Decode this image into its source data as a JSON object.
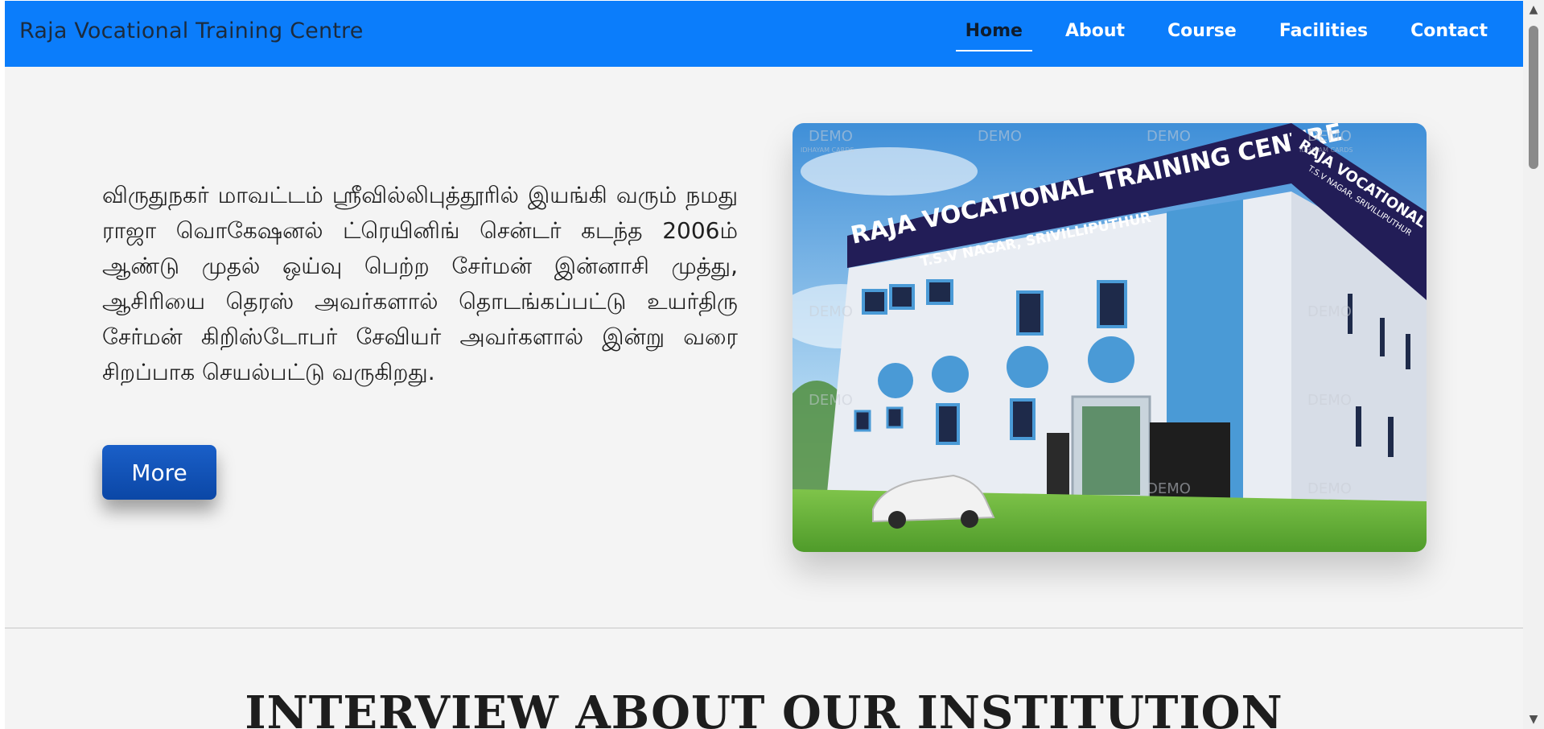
{
  "navbar": {
    "brand": "Raja Vocational Training Centre",
    "links": [
      {
        "label": "Home",
        "active": true
      },
      {
        "label": "About",
        "active": false
      },
      {
        "label": "Course",
        "active": false
      },
      {
        "label": "Facilities",
        "active": false
      },
      {
        "label": "Contact",
        "active": false
      }
    ]
  },
  "hero": {
    "text": "விருதுநகர் மாவட்டம் ஸ்ரீவில்லிபுத்தூரில் இயங்கி வரும் நமது ராஜா வொகேஷனல் ட்ரெயினிங் சென்டர் கடந்த 2006ம் ஆண்டு முதல் ஒய்வு பெற்ற சேர்மன் இன்னாசி முத்து, ஆசிரியை தெரஸ் அவர்களால் தொடங்கப்பட்டு உயர்திரு சேர்மன் கிறிஸ்டோபர் சேவியர் அவர்களால் இன்று வரை சிறப்பாக செயல்பட்டு வருகிறது.",
    "button": "More",
    "image": {
      "sign_main": "RAJA VOCATIONAL TRAINING CENTRE",
      "sign_sub": "T.S.V NAGAR, SRIVILLIPUTHUR",
      "side_sign_main": "RAJA VOCATIONAL TRAINING",
      "side_sign_sub": "T.S.V NAGAR, SRIVILLIPUTHUR",
      "watermark": "DEMO",
      "watermark_sub": "IDHAYAM CARDS"
    }
  },
  "section": {
    "title": "INTERVIEW ABOUT OUR INSTITUTION"
  },
  "colors": {
    "navbar": "#0b7dfb",
    "button": "#0b47a6",
    "page_bg": "#f4f4f4"
  },
  "icons": {
    "scroll_up": "triangle-up-icon",
    "scroll_down": "triangle-down-icon"
  }
}
